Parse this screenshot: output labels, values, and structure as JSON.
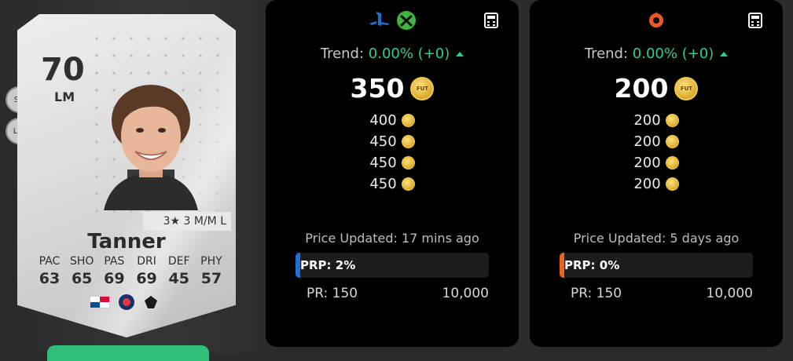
{
  "player": {
    "rating": "70",
    "position": "LM",
    "alt_positions": [
      "ST",
      "LW"
    ],
    "skills_line": "3★ 3 M/M L",
    "name": "Tanner",
    "stats": [
      {
        "label": "PAC",
        "value": "63"
      },
      {
        "label": "SHO",
        "value": "65"
      },
      {
        "label": "PAS",
        "value": "69"
      },
      {
        "label": "DRI",
        "value": "69"
      },
      {
        "label": "DEF",
        "value": "45"
      },
      {
        "label": "PHY",
        "value": "57"
      }
    ],
    "badges": [
      "panama-flag",
      "league-crest",
      "club-crest"
    ]
  },
  "panels": [
    {
      "platform_icons": [
        "playstation-icon",
        "xbox-icon"
      ],
      "trend_label": "Trend:",
      "trend_value": "0.00% (+0)",
      "main_price": "350",
      "prices": [
        "400",
        "450",
        "450",
        "450"
      ],
      "updated": "Price Updated: 17 mins ago",
      "prp_label": "PRP: 2%",
      "prp_fraction": 0.02,
      "pr_min": "PR: 150",
      "pr_max": "10,000",
      "accent": "#1e6fd9"
    },
    {
      "platform_icons": [
        "origin-icon"
      ],
      "trend_label": "Trend:",
      "trend_value": "0.00% (+0)",
      "main_price": "200",
      "prices": [
        "200",
        "200",
        "200",
        "200"
      ],
      "updated": "Price Updated: 5 days ago",
      "prp_label": "PRP: 0%",
      "prp_fraction": 0.0,
      "pr_min": "PR: 150",
      "pr_max": "10,000",
      "accent": "#e8641f"
    }
  ],
  "coin_text": "FUT",
  "colors": {
    "trend_green": "#2ecc8f",
    "coin_gold": "#e0b43a",
    "panel_bg": "#000000"
  }
}
